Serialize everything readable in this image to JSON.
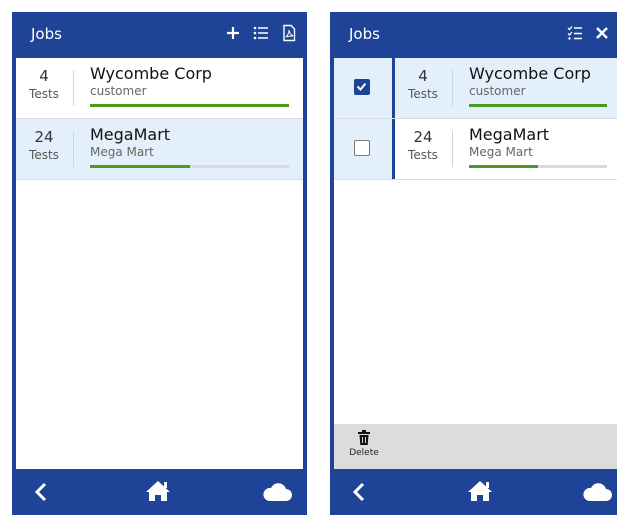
{
  "left": {
    "title": "Jobs",
    "toolbar_icons": [
      "plus-icon",
      "list-icon",
      "pdf-icon"
    ],
    "rows": [
      {
        "count": "4",
        "count_label": "Tests",
        "name": "Wycombe Corp",
        "sub": "customer",
        "progress": 1.0,
        "selected": false
      },
      {
        "count": "24",
        "count_label": "Tests",
        "name": "MegaMart",
        "sub": "Mega Mart",
        "progress": 0.5,
        "selected": true
      }
    ],
    "bottom_nav": [
      "back-icon",
      "home-icon",
      "cloud-icon"
    ]
  },
  "right": {
    "title": "Jobs",
    "toolbar_icons": [
      "checklist-icon",
      "close-icon"
    ],
    "rows": [
      {
        "checked": true,
        "count": "4",
        "count_label": "Tests",
        "name": "Wycombe Corp",
        "sub": "customer",
        "progress": 1.0
      },
      {
        "checked": false,
        "count": "24",
        "count_label": "Tests",
        "name": "MegaMart",
        "sub": "Mega Mart",
        "progress": 0.5
      }
    ],
    "action": {
      "icon": "trash-icon",
      "label": "Delete"
    },
    "bottom_nav": [
      "back-icon",
      "home-icon",
      "cloud-icon"
    ]
  },
  "colors": {
    "primary": "#1f4396",
    "selected_row": "#e3f0fb",
    "progress": "#4a9a1c",
    "progress_track": "#d9d9d9",
    "action_bar": "#dcdcdc"
  }
}
